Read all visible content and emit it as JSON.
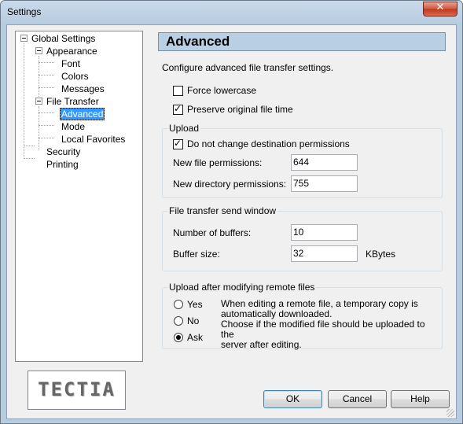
{
  "window": {
    "title": "Settings",
    "close_glyph": "✕"
  },
  "tree": {
    "root": "Global Settings",
    "appearance": "Appearance",
    "font": "Font",
    "colors": "Colors",
    "messages": "Messages",
    "file_transfer": "File Transfer",
    "advanced": "Advanced",
    "mode": "Mode",
    "local_favorites": "Local Favorites",
    "security": "Security",
    "printing": "Printing"
  },
  "logo": {
    "text": "TECTIA"
  },
  "panel": {
    "title": "Advanced",
    "description": "Configure advanced file transfer settings.",
    "force_lowercase": {
      "label": "Force lowercase",
      "checked": false
    },
    "preserve_time": {
      "label": "Preserve original file time",
      "checked": true
    }
  },
  "upload": {
    "title": "Upload",
    "no_change_perms": {
      "label": "Do not change destination permissions",
      "checked": true
    },
    "new_file_perms_label": "New file permissions:",
    "new_file_perms_value": "644",
    "new_dir_perms_label": "New directory permissions:",
    "new_dir_perms_value": "755"
  },
  "send_window": {
    "title": "File transfer send window",
    "buffers_label": "Number of buffers:",
    "buffers_value": "10",
    "buffer_size_label": "Buffer size:",
    "buffer_size_value": "32",
    "buffer_size_unit": "KBytes"
  },
  "after_modify": {
    "title": "Upload after modifying remote files",
    "options": [
      "Yes",
      "No",
      "Ask"
    ],
    "selected": "Ask",
    "note_line1": "When editing a remote file, a temporary copy is",
    "note_line2": "automatically downloaded.",
    "note_line3": "Choose if the modified file should be uploaded to the",
    "note_line4": "server after editing."
  },
  "buttons": {
    "ok": "OK",
    "cancel": "Cancel",
    "help": "Help"
  },
  "colors": {
    "header_bar": "#b9cfe4",
    "selection": "#3399ff",
    "close_button": "#c0361d"
  }
}
